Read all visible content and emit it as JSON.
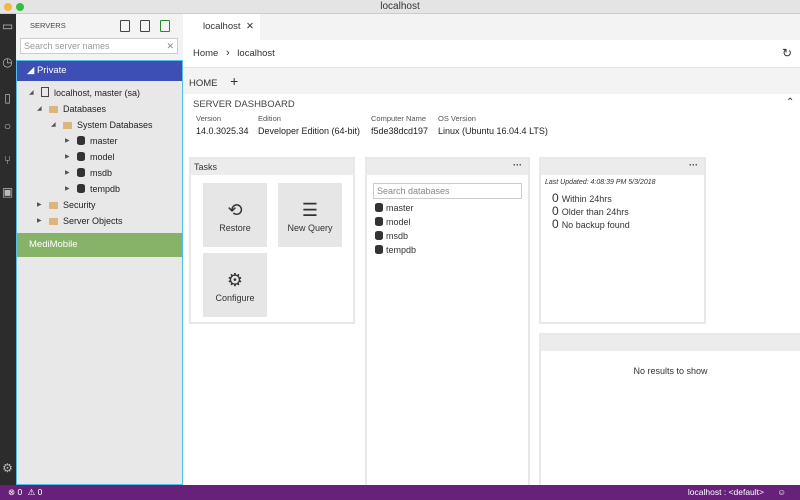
{
  "window": {
    "title": "localhost"
  },
  "sidebar": {
    "header": "SERVERS",
    "search_placeholder": "Search server names",
    "group_private": "Private",
    "tree": [
      {
        "label": "localhost, master (sa)",
        "type": "server",
        "depth": 0,
        "expanded": true
      },
      {
        "label": "Databases",
        "type": "folder",
        "depth": 1,
        "expanded": true
      },
      {
        "label": "System Databases",
        "type": "folder",
        "depth": 2,
        "expanded": true
      },
      {
        "label": "master",
        "type": "db",
        "depth": 3
      },
      {
        "label": "model",
        "type": "db",
        "depth": 3
      },
      {
        "label": "msdb",
        "type": "db",
        "depth": 3
      },
      {
        "label": "tempdb",
        "type": "db",
        "depth": 3
      },
      {
        "label": "Security",
        "type": "folder",
        "depth": 1
      },
      {
        "label": "Server Objects",
        "type": "folder",
        "depth": 1
      }
    ],
    "group_medimobile": "MediMobile"
  },
  "editor": {
    "tab_label": "localhost",
    "breadcrumb": [
      "Home",
      "localhost"
    ],
    "home_tab": "HOME"
  },
  "dashboard": {
    "title": "SERVER DASHBOARD",
    "props": [
      {
        "k": "Version",
        "v": "14.0.3025.34"
      },
      {
        "k": "Edition",
        "v": "Developer Edition (64-bit)"
      },
      {
        "k": "Computer Name",
        "v": "f5de38dcd197"
      },
      {
        "k": "OS Version",
        "v": "Linux (Ubuntu 16.04.4 LTS)"
      }
    ],
    "tasks": {
      "title": "Tasks",
      "items": [
        "Restore",
        "New Query",
        "Configure"
      ]
    },
    "databases": {
      "search_placeholder": "Search databases",
      "items": [
        "master",
        "model",
        "msdb",
        "tempdb"
      ]
    },
    "backup": {
      "last_updated": "Last Updated: 4:08:39 PM 5/3/2018",
      "rows": [
        {
          "n": "0",
          "label": "Within 24hrs"
        },
        {
          "n": "0",
          "label": "Older than 24hrs"
        },
        {
          "n": "0",
          "label": "No backup found"
        }
      ]
    },
    "empty": "No results to show"
  },
  "status": {
    "errors": "0",
    "warnings": "0",
    "connection": "localhost : <default>"
  }
}
